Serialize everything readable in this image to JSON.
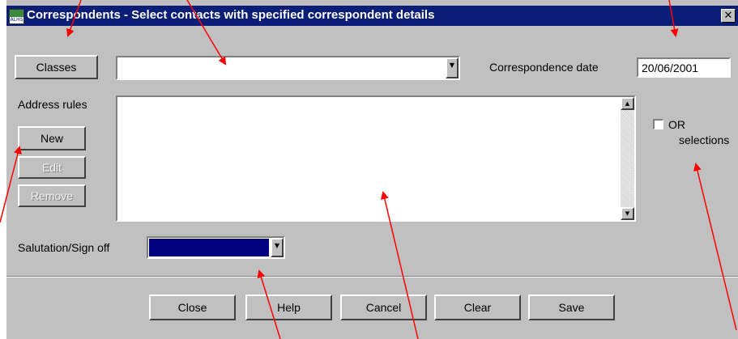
{
  "window": {
    "title": "Correspondents - Select contacts with specified correspondent details",
    "icon_text": "ALHS",
    "close_glyph": "✕",
    "title_bar_color": "#0a1e78"
  },
  "classes": {
    "button_label": "Classes",
    "combo_value": ""
  },
  "correspondence_date": {
    "label": "Correspondence date",
    "value": "20/06/2001"
  },
  "address_rules": {
    "label": "Address rules",
    "buttons": {
      "new": "New",
      "edit": "Edit",
      "remove": "Remove"
    },
    "list_items": []
  },
  "or_selections": {
    "line1": "OR",
    "line2": "selections",
    "checked": false
  },
  "salutation": {
    "label": "Salutation/Sign off",
    "value": "",
    "selected_color": "#000080"
  },
  "footer_buttons": {
    "close": "Close",
    "help": "Help",
    "cancel": "Cancel",
    "clear": "Clear",
    "save": "Save"
  },
  "icons": {
    "combo_arrow": "▼",
    "scroll_up": "▲",
    "scroll_down": "▼"
  },
  "annotation_color": "#ff0000"
}
